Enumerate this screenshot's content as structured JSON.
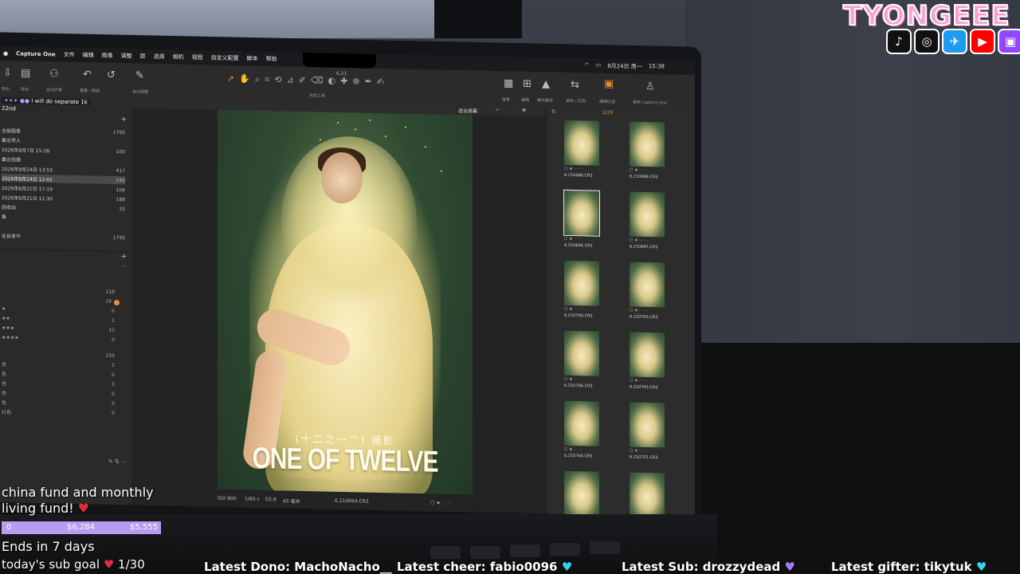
{
  "menubar": {
    "app": "Capture One",
    "items": [
      "文件",
      "编辑",
      "图像",
      "调整",
      "层",
      "选择",
      "相机",
      "视图",
      "自定义配置",
      "脚本",
      "帮助"
    ],
    "date": "8月24日 周一",
    "time": "15:38"
  },
  "window_title": "6.21",
  "toolbar": {
    "left_labels": [
      "导出",
      "导出",
      "自动共享",
      "重置 / 撤销",
      "自动调整"
    ],
    "center_label": "光标工具",
    "right_labels": [
      "查看",
      "编辑",
      "曝光警告",
      "复制 / 应用",
      "编辑已选",
      "使用 Capture One"
    ]
  },
  "left_panel": {
    "overlay_message": "I will do separate 1k",
    "date_label": "22nd",
    "rows": [
      {
        "label": "全部图像",
        "count": "1795"
      },
      {
        "label": "最近导入",
        "count": ""
      },
      {
        "label": "2026年8月7日 15:28",
        "count": "100"
      },
      {
        "label": "最近拍摄",
        "count": ""
      },
      {
        "label": "2026年8月24日 13:53",
        "count": "417"
      },
      {
        "label": "2026年8月24日 12:02",
        "count": "240"
      },
      {
        "label": "2026年6月21日 17:19",
        "count": "104"
      },
      {
        "label": "2026年6月21日 11:30",
        "count": "188"
      },
      {
        "label": "回收站",
        "count": "33"
      },
      {
        "label": "集",
        "count": ""
      },
      {
        "label": "",
        "count": ""
      },
      {
        "label": "在目录中",
        "count": "1795"
      }
    ],
    "ratings": [
      {
        "label": "",
        "count": "218"
      },
      {
        "label": "",
        "count": "29"
      },
      {
        "label": "★",
        "count": "0"
      },
      {
        "label": "★★",
        "count": "1"
      },
      {
        "label": "★★★",
        "count": "12"
      },
      {
        "label": "★★★★",
        "count": "0"
      }
    ],
    "colors": [
      {
        "label": "",
        "count": "259"
      },
      {
        "label": "色",
        "count": "1"
      },
      {
        "label": "色",
        "count": "0"
      },
      {
        "label": "色",
        "count": "0"
      },
      {
        "label": "色",
        "count": "0"
      },
      {
        "label": "色",
        "count": "0"
      },
      {
        "label": "红色",
        "count": "0"
      }
    ]
  },
  "viewer": {
    "zoom_label": "适合屏幕",
    "photo_subtitle": "(十二之一™) 摄影",
    "photo_title": "ONE OF TWELVE",
    "footer": {
      "iso": "ISO 800",
      "shutter": "1/60 s",
      "aperture": "f/2.8",
      "focal": "45 毫米",
      "filename": "6.210694.CR3"
    }
  },
  "browser": {
    "counter": "1/29",
    "thumbs": [
      {
        "file": "6.210686.CR3",
        "selected": false
      },
      {
        "file": "6.210688.CR3",
        "selected": false
      },
      {
        "file": "6.210694.CR3",
        "selected": true
      },
      {
        "file": "6.210697.CR3",
        "selected": false
      },
      {
        "file": "6.210700.CR3",
        "selected": false
      },
      {
        "file": "6.210703.CR3",
        "selected": false
      },
      {
        "file": "6.210706.CR3",
        "selected": false
      },
      {
        "file": "6.210743.CR3",
        "selected": false
      },
      {
        "file": "6.210744.CR3",
        "selected": false
      },
      {
        "file": "6.210751.CR3",
        "selected": false
      },
      {
        "file": "",
        "selected": false
      },
      {
        "file": "",
        "selected": false
      }
    ]
  },
  "stream": {
    "brand": "TYONGEEE",
    "socials": [
      "tiktok-icon",
      "instagram-icon",
      "twitter-icon",
      "youtube-icon",
      "twitch-icon"
    ],
    "goal_line1": "china fund and monthly",
    "goal_line2": "living fund!",
    "goal_bar_start": "0",
    "goal_bar_current": "$6,284",
    "goal_bar_target": "$5,555",
    "goal_progress": 1.0,
    "ends": "Ends in 7 days",
    "sub_goal_label": "today's sub goal",
    "sub_goal_value": "1/30",
    "latest_dono": "Latest Dono: MachoNacho__",
    "latest_cheer": "Latest cheer: fabio0096",
    "latest_sub": "Latest Sub: drozzydead",
    "latest_gifter": "Latest gifter: tikytuk"
  }
}
